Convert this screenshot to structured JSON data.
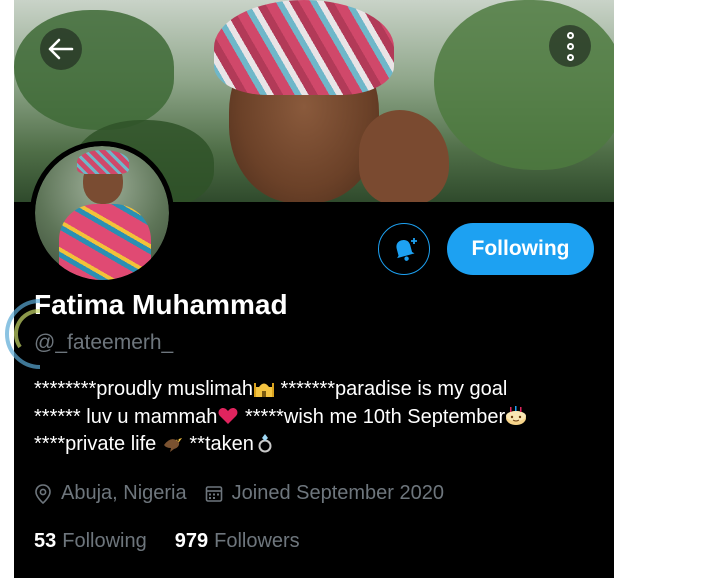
{
  "profile": {
    "name": "Fatima Muhammad",
    "handle": "@_fateemerh_",
    "bio": [
      "********proudly muslimah",
      " *******paradise is my goal",
      "****** luv u mammah",
      " *****wish me 10th September",
      "****private life ",
      " **taken"
    ],
    "location": "Abuja, Nigeria",
    "joined": "Joined September 2020",
    "following_count": "53",
    "following_label": "Following",
    "followers_count": "979",
    "followers_label": "Followers"
  },
  "actions": {
    "follow_state_label": "Following",
    "notify_icon": "bell-plus-icon",
    "back_icon": "arrow-left-icon",
    "more_icon": "more-vertical-icon"
  },
  "colors": {
    "accent": "#1da1f2",
    "background": "#000000",
    "secondary_text": "#6e767d"
  }
}
